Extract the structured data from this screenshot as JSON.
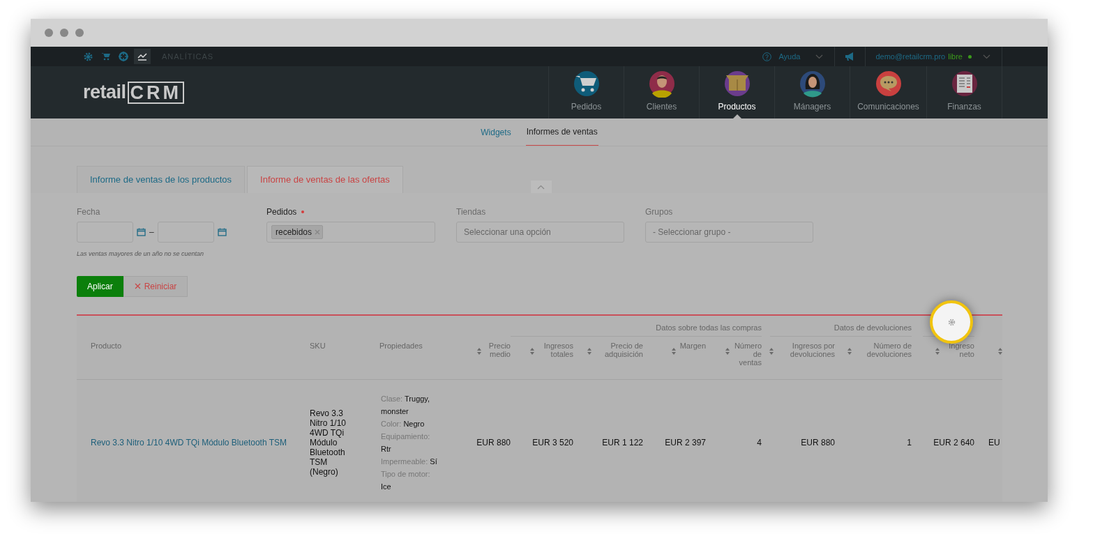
{
  "top_bar": {
    "section": "ANALÍTICAS",
    "help": "Ayuda",
    "user": {
      "email": "demo@retailcrm.pro",
      "plan": "libre",
      "online": true
    }
  },
  "logo": {
    "prefix": "retail",
    "mark": "CRM"
  },
  "nav": [
    {
      "label": "Pedidos",
      "kind": "cart",
      "selected": false
    },
    {
      "label": "Clientes",
      "kind": "man",
      "selected": false
    },
    {
      "label": "Productos",
      "kind": "box",
      "selected": true
    },
    {
      "label": "Mánagers",
      "kind": "woman",
      "selected": false
    },
    {
      "label": "Comunicaciones",
      "kind": "chat",
      "selected": false
    },
    {
      "label": "Finanzas",
      "kind": "ledger",
      "selected": false
    }
  ],
  "subtabs": [
    {
      "label": "Widgets",
      "selected": false
    },
    {
      "label": "Informes de ventas",
      "selected": true
    }
  ],
  "report_tabs": [
    {
      "label": "Informe de ventas de los productos",
      "selected": false
    },
    {
      "label": "Informe de ventas de las ofertas",
      "selected": true
    }
  ],
  "filters": {
    "date": {
      "label": "Fecha",
      "separator": "–",
      "hint": "Las ventas mayores de un año no se cuentan"
    },
    "orders": {
      "label": "Pedidos",
      "required": true,
      "tags": [
        "recebidos"
      ]
    },
    "stores": {
      "label": "Tiendas",
      "placeholder": "Seleccionar una opción"
    },
    "groups": {
      "label": "Grupos",
      "placeholder": "- Seleccionar grupo -"
    }
  },
  "buttons": {
    "apply": "Aplicar",
    "reset": "Reiniciar"
  },
  "table": {
    "groups": [
      {
        "label": "Datos sobre todas las compras"
      },
      {
        "label": "Datos de devoluciones"
      }
    ],
    "columns": [
      {
        "label": "Producto",
        "sortable": false
      },
      {
        "label": "SKU",
        "sortable": false
      },
      {
        "label": "Propiedades",
        "sortable": false
      },
      {
        "label": "Precio medio",
        "sortable": true
      },
      {
        "label": "Ingresos totales",
        "sortable": true
      },
      {
        "label": "Precio de adquisición",
        "sortable": true
      },
      {
        "label": "Margen",
        "sortable": true
      },
      {
        "label": "Número de ventas",
        "sortable": true
      },
      {
        "label": "Ingresos por devoluciones",
        "sortable": true
      },
      {
        "label": "Número de devoluciones",
        "sortable": true
      },
      {
        "label": "Ingreso neto",
        "sortable": true
      },
      {
        "sortable": true
      }
    ],
    "rows": [
      {
        "product": "Revo 3.3 Nitro 1/10 4WD TQi Módulo Bluetooth TSM",
        "sku": "Revo 3.3 Nitro 1/10 4WD TQi Módulo Bluetooth TSM (Negro)",
        "properties": [
          {
            "label": "Clase:",
            "value": "Truggy, monster"
          },
          {
            "label": "Color:",
            "value": "Negro"
          },
          {
            "label": "Equipamiento:",
            "value": "Rtr"
          },
          {
            "label": "Impermeable:",
            "value": "Sí"
          },
          {
            "label": "Tipo de motor:",
            "value": "Ice"
          }
        ],
        "values": [
          "EUR 880",
          "EUR 3 520",
          "EUR 1 122",
          "EUR 2 397",
          "4",
          "EUR 880",
          "1",
          "EUR 2 640",
          "EU"
        ]
      }
    ]
  }
}
